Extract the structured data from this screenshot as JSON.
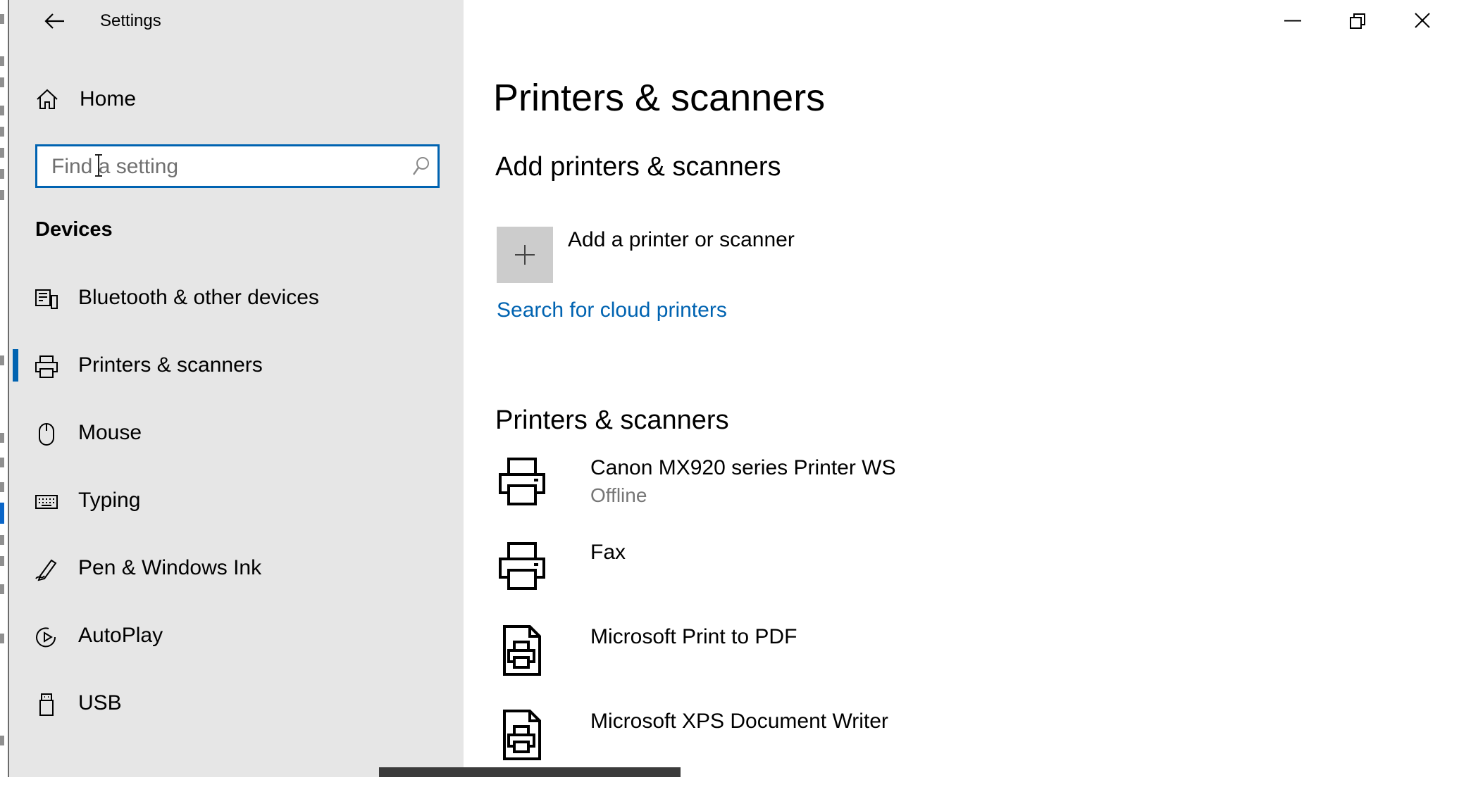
{
  "window": {
    "title": "Settings"
  },
  "sidebar": {
    "home_label": "Home",
    "search": {
      "placeholder": "Find a setting",
      "value": ""
    },
    "section_title": "Devices",
    "items": [
      {
        "label": "Bluetooth & other devices",
        "icon": "bluetooth-devices-icon",
        "selected": false
      },
      {
        "label": "Printers & scanners",
        "icon": "printer-icon",
        "selected": true
      },
      {
        "label": "Mouse",
        "icon": "mouse-icon",
        "selected": false
      },
      {
        "label": "Typing",
        "icon": "keyboard-icon",
        "selected": false
      },
      {
        "label": "Pen & Windows Ink",
        "icon": "pen-icon",
        "selected": false
      },
      {
        "label": "AutoPlay",
        "icon": "autoplay-icon",
        "selected": false
      },
      {
        "label": "USB",
        "icon": "usb-icon",
        "selected": false
      }
    ]
  },
  "main": {
    "page_title": "Printers & scanners",
    "add_section_title": "Add printers & scanners",
    "add_button_label": "Add a printer or scanner",
    "cloud_link": "Search for cloud printers",
    "list_title": "Printers & scanners",
    "devices": [
      {
        "name": "Canon MX920 series Printer WS",
        "status": "Offline",
        "icon": "printer-icon"
      },
      {
        "name": "Fax",
        "status": "",
        "icon": "printer-icon"
      },
      {
        "name": "Microsoft Print to PDF",
        "status": "",
        "icon": "document-printer-icon"
      },
      {
        "name": "Microsoft XPS Document Writer",
        "status": "",
        "icon": "document-printer-icon"
      }
    ]
  },
  "colors": {
    "accent": "#0063b1",
    "sidebar_bg": "#e6e6e6",
    "secondary_text": "#767676",
    "add_tile_bg": "#cccccc"
  }
}
